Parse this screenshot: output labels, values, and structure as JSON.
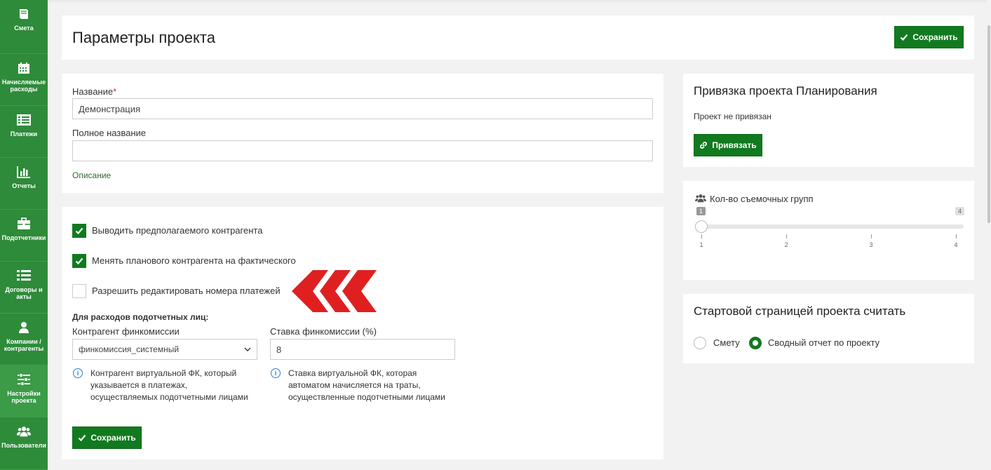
{
  "sidebar": {
    "items": [
      {
        "label": "Смета",
        "icon": "book-icon"
      },
      {
        "label": "Начисляемые расходы",
        "icon": "calendar-icon"
      },
      {
        "label": "Платежи",
        "icon": "list-card-icon"
      },
      {
        "label": "Отчеты",
        "icon": "bar-chart-icon"
      },
      {
        "label": "Подотчетники",
        "icon": "briefcase-icon"
      },
      {
        "label": "Договоры и акты",
        "icon": "list-icon"
      },
      {
        "label": "Компании / контрагенты",
        "icon": "user-icon"
      },
      {
        "label": "Настройки проекта",
        "icon": "sliders-icon"
      },
      {
        "label": "Пользователи",
        "icon": "users-icon"
      }
    ]
  },
  "header": {
    "title": "Параметры проекта",
    "save_label": "Сохранить"
  },
  "form": {
    "name_label": "Название",
    "name_required": "*",
    "name_value": "Демонстрация",
    "full_name_label": "Полное название",
    "full_name_value": "",
    "description_link": "Описание"
  },
  "options": {
    "checkboxes": [
      {
        "label": "Выводить предполагаемого контрагента",
        "checked": true
      },
      {
        "label": "Менять планового контрагента на фактического",
        "checked": true
      },
      {
        "label": "Разрешить редактировать номера платежей",
        "checked": false
      }
    ],
    "section_label": "Для расходов подотчетных лиц:",
    "counterparty_label": "Контрагент финкомиссии",
    "counterparty_value": "финкомиссия_системный",
    "rate_label": "Ставка финкомиссии (%)",
    "rate_value": "8",
    "counterparty_help_1": "Контрагент виртуальной ФК, который",
    "counterparty_help_2": "указывается в платежах,",
    "counterparty_help_3": "осуществляемых подотчетными лицами",
    "rate_help_1": "Ставка виртуальной ФК, которая",
    "rate_help_2": "автоматом начисляется на траты,",
    "rate_help_3": "осуществленные подотчетными лицами",
    "save_label": "Сохранить"
  },
  "planning": {
    "title": "Привязка проекта Планирования",
    "status": "Проект не привязан",
    "bind_label": "Привязать"
  },
  "crews": {
    "title": "Кол-во съемочных групп",
    "min": 1,
    "max": 4,
    "value": 1,
    "badge_min": "1",
    "badge_max": "4",
    "ticks": [
      "1",
      "2",
      "3",
      "4"
    ]
  },
  "start_page": {
    "title": "Стартовой страницей проекта считать",
    "options": [
      {
        "label": "Смету",
        "selected": false
      },
      {
        "label": "Сводный отчет по проекту",
        "selected": true
      }
    ]
  },
  "colors": {
    "sidebar": "#2e8b3a",
    "accent": "#117a1f",
    "annotation_arrow": "#e02020"
  }
}
